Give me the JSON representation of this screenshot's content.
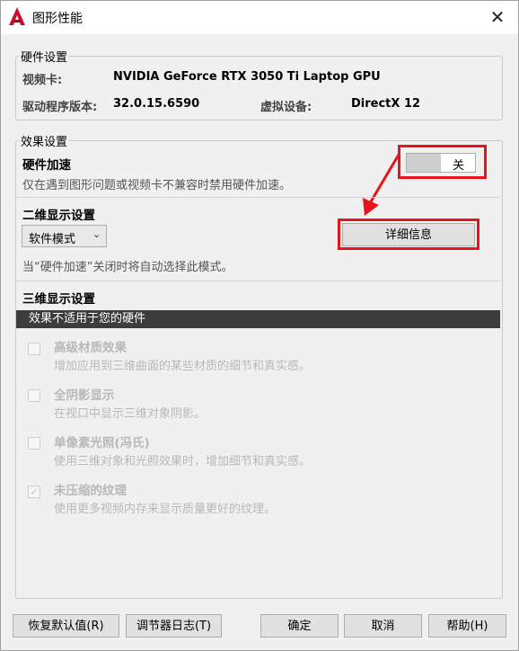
{
  "window": {
    "title": "图形性能",
    "close_symbol": "✕"
  },
  "hardware": {
    "legend": "硬件设置",
    "video_card_label": "视频卡:",
    "video_card_value": "NVIDIA GeForce RTX 3050 Ti Laptop GPU",
    "driver_label": "驱动程序版本:",
    "driver_value": "32.0.15.6590",
    "virtual_label": "虚拟设备:",
    "virtual_value": "DirectX 12"
  },
  "effects": {
    "legend": "效果设置",
    "accel_title": "硬件加速",
    "accel_desc": "仅在遇到图形问题或视频卡不兼容时禁用硬件加速。",
    "toggle_label": "关",
    "twod_title": "二维显示设置",
    "twod_mode": "软件模式",
    "details_button": "详细信息",
    "twod_desc": "当“硬件加速”关闭时将自动选择此模式。",
    "threed_title": "三维显示设置",
    "not_applicable": "效果不适用于您的硬件",
    "options": [
      {
        "title": "高级材质效果",
        "desc": "增加应用到三维曲面的某些材质的细节和真实感。",
        "checked": false
      },
      {
        "title": "全阴影显示",
        "desc": "在视口中显示三维对象阴影。",
        "checked": false
      },
      {
        "title": "单像素光照(冯氏)",
        "desc": "使用三维对象和光照效果时，增加细节和真实感。",
        "checked": false
      },
      {
        "title": "未压缩的纹理",
        "desc": "使用更多视频内存来显示质量更好的纹理。",
        "checked": true
      }
    ]
  },
  "footer": {
    "reset": "恢复默认值(R)",
    "tuner_log": "调节器日志(T)",
    "ok": "确定",
    "cancel": "取消",
    "help": "帮助(H)"
  },
  "colors": {
    "highlight": "#e8141c",
    "dark_bar": "#3c3c3c",
    "brand": "#c8102e"
  }
}
